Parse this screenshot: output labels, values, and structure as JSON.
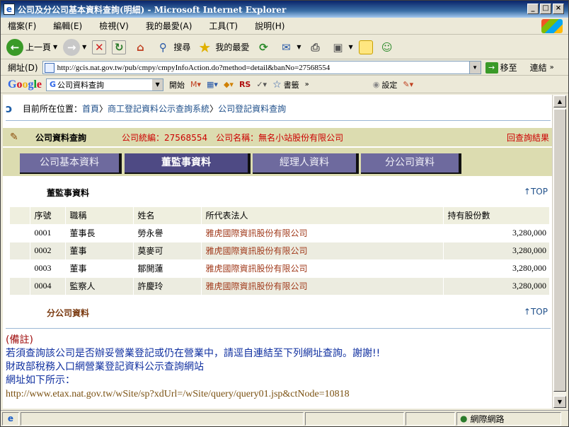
{
  "window": {
    "title": "公司及分公司基本資料查詢(明細) - Microsoft Internet Explorer"
  },
  "menu": [
    "檔案(F)",
    "編輯(E)",
    "檢視(V)",
    "我的最愛(A)",
    "工具(T)",
    "說明(H)"
  ],
  "toolbar": {
    "back": "上一頁",
    "search": "搜尋",
    "favorites": "我的最愛"
  },
  "address": {
    "label": "網址(D)",
    "url": "http://gcis.nat.gov.tw/pub/cmpy/cmpyInfoAction.do?method=detail&banNo=27568554",
    "go": "移至",
    "links": "連結"
  },
  "googlebar": {
    "logo": "Google",
    "search": "公司資料查詢",
    "open": "開始",
    "rs": "RS",
    "bookmarks": "書籤",
    "settings": "設定"
  },
  "breadcrumb": {
    "prefix": "目前所在位置：",
    "home": "首頁",
    "sep1": "〉",
    "system": "商工登記資料公示查詢系統",
    "sep2": "〉",
    "current": "公司登記資料查詢"
  },
  "query": {
    "title": "公司資料查詢",
    "company_info": "公司統編：27568554　公司名稱：無名小站股份有限公司",
    "return": "回查詢結果"
  },
  "tabs": [
    "公司基本資料",
    "董監事資料",
    "經理人資料",
    "分公司資料"
  ],
  "section_directors": "董監事資料",
  "section_branches": "分公司資料",
  "top_link": "↑TOP",
  "table": {
    "headers": [
      "序號",
      "職稱",
      "姓名",
      "所代表法人",
      "持有股份數"
    ],
    "rows": [
      [
        "0001",
        "董事長",
        "勞永譽",
        "雅虎國際資訊股份有限公司",
        "3,280,000"
      ],
      [
        "0002",
        "董事",
        "莫麥可",
        "雅虎國際資訊股份有限公司",
        "3,280,000"
      ],
      [
        "0003",
        "董事",
        "鄒開蓮",
        "雅虎國際資訊股份有限公司",
        "3,280,000"
      ],
      [
        "0004",
        "監察人",
        "許慶玲",
        "雅虎國際資訊股份有限公司",
        "3,280,000"
      ]
    ]
  },
  "notes": {
    "remark": "(備註)",
    "line1": "若須查詢該公司是否辦妥營業登記或仍在營業中，請逕自連結至下列網址查詢。謝謝!!",
    "line2": "財政部稅務入口網營業登記資料公示查詢網站",
    "line3": "網址如下所示：",
    "url": "http://www.etax.nat.gov.tw/wSite/sp?xdUrl=/wSite/query/query01.jsp&ctNode=10818"
  },
  "status": {
    "zone": "網際網路"
  }
}
